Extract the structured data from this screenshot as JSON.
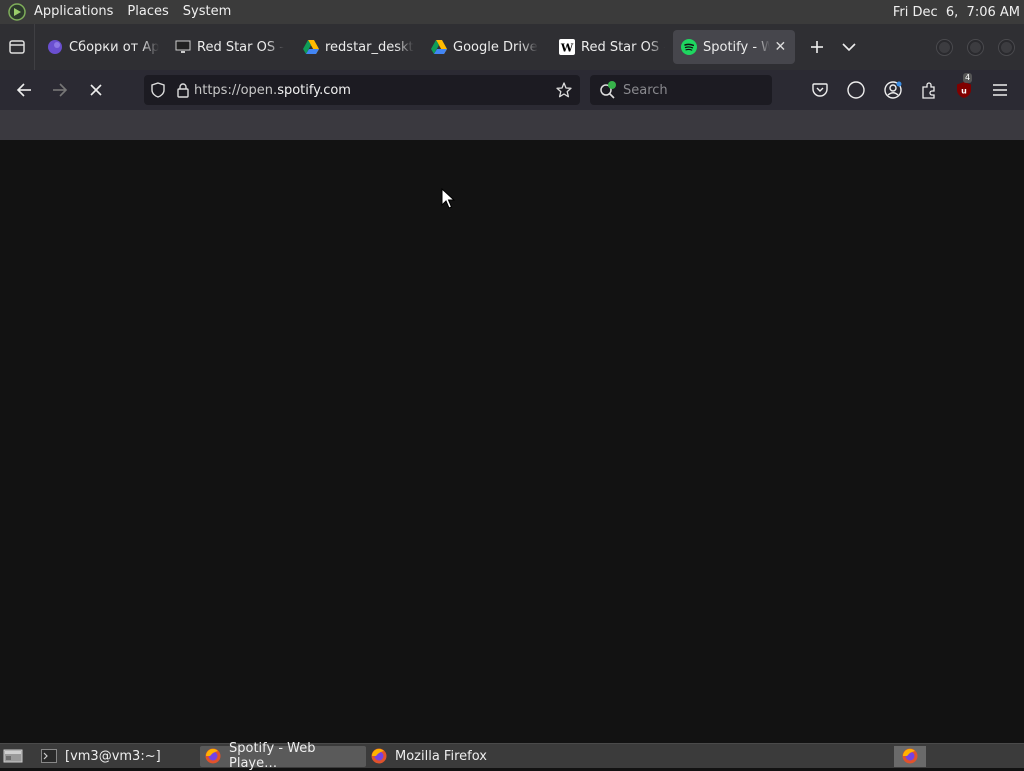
{
  "top_panel": {
    "menus": [
      "Applications",
      "Places",
      "System"
    ],
    "clock": "Fri Dec  6,  7:06 AM"
  },
  "tabs": [
    {
      "label": "Сборки от Ар",
      "icon": "purple-app-icon"
    },
    {
      "label": "Red Star OS -",
      "icon": "monitor-icon"
    },
    {
      "label": "redstar_deskt",
      "icon": "google-drive-icon"
    },
    {
      "label": "Google Drive",
      "icon": "google-drive-icon"
    },
    {
      "label": "Red Star OS -",
      "icon": "wikipedia-icon"
    },
    {
      "label": "Spotify - W",
      "icon": "spotify-icon",
      "active": true
    }
  ],
  "nav": {
    "url_prefix": "https://open.",
    "url_host": "spotify.com",
    "search_placeholder": "Search",
    "extension_badge": "4"
  },
  "taskbar": {
    "items": [
      {
        "label": "[vm3@vm3:~]",
        "icon": "terminal-icon"
      },
      {
        "label": "Spotify - Web Playe…",
        "icon": "firefox-icon",
        "active": true
      },
      {
        "label": "Mozilla Firefox",
        "icon": "firefox-icon"
      }
    ]
  },
  "colors": {
    "content_bg": "#121212",
    "spotify_green": "#1ed760",
    "panel_bg": "#3b3b3b"
  }
}
